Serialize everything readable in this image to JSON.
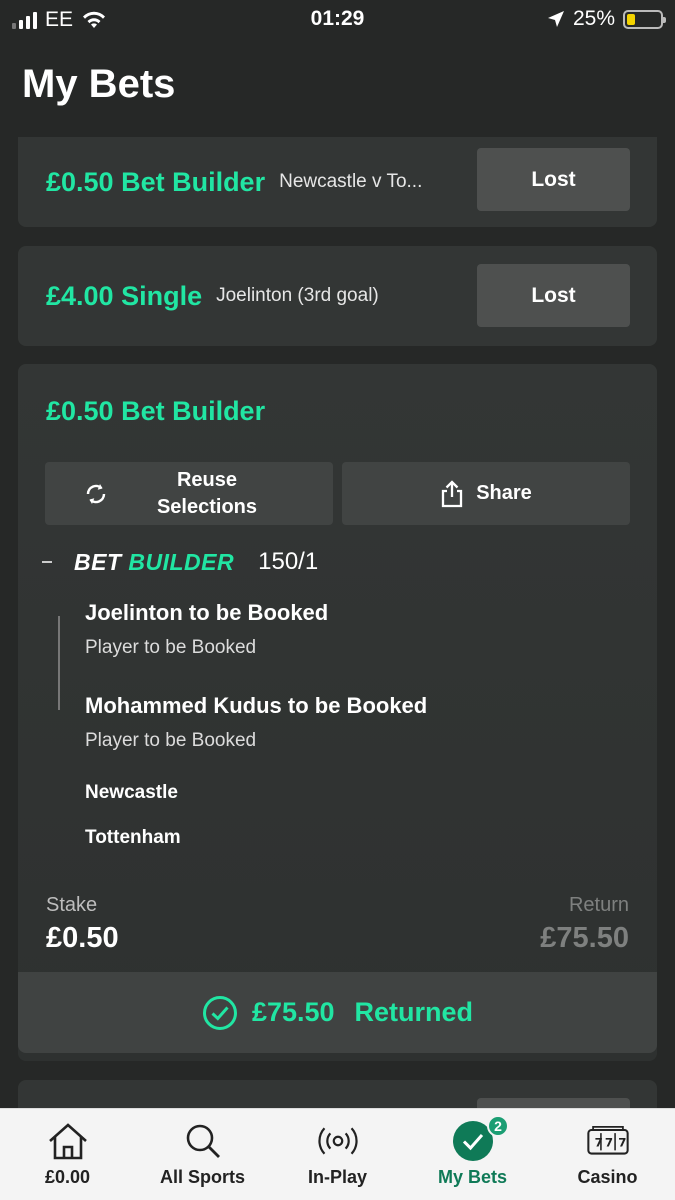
{
  "status_bar": {
    "carrier": "EE",
    "time": "01:29",
    "battery": "25%",
    "battery_level": 0.25
  },
  "page": {
    "title": "My Bets"
  },
  "bets": [
    {
      "amount": "£0.50 Bet Builder",
      "description": "Newcastle v To...",
      "status": "Lost"
    },
    {
      "amount": "£4.00 Single",
      "description": "Joelinton (3rd goal)",
      "status": "Lost"
    }
  ],
  "expanded_bet": {
    "amount": "£0.50 Bet Builder",
    "reuse_label_line1": "Reuse",
    "reuse_label_line2": "Selections",
    "share_label": "Share",
    "bet_builder_word1": "BET",
    "bet_builder_word2": "BUILDER",
    "odds": "150/1",
    "legs": [
      {
        "title": "Joelinton to be Booked",
        "market": "Player to be Booked"
      },
      {
        "title": "Mohammed Kudus to be Booked",
        "market": "Player to be Booked"
      }
    ],
    "teams": [
      "Newcastle",
      "Tottenham"
    ],
    "stake_label": "Stake",
    "stake_value": "£0.50",
    "return_label": "Return",
    "return_value": "£75.50",
    "returned_amount": "£75.50",
    "returned_label": "Returned"
  },
  "bottom_nav": {
    "items": [
      {
        "label": "£0.00",
        "icon": "home-icon"
      },
      {
        "label": "All Sports",
        "icon": "search-icon"
      },
      {
        "label": "In-Play",
        "icon": "broadcast-icon"
      },
      {
        "label": "My Bets",
        "icon": "check-icon",
        "badge": "2"
      },
      {
        "label": "Casino",
        "icon": "slot-machine-icon"
      }
    ]
  },
  "colors": {
    "accent": "#21e6a3",
    "background": "#262827",
    "card": "#333635",
    "nav_active": "#0f7a57"
  }
}
